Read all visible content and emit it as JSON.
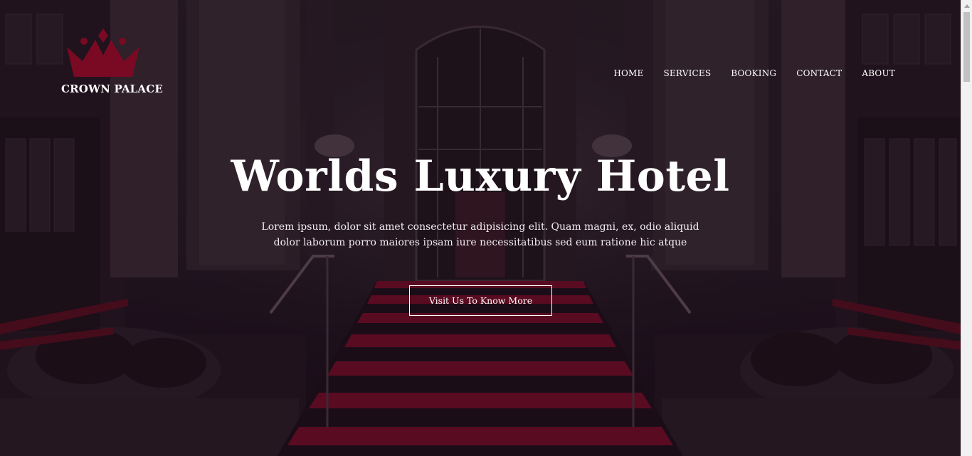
{
  "brand": {
    "name": "CROWN PALACE",
    "logo_icon": "crown-icon",
    "logo_color": "#7a0a23"
  },
  "nav": {
    "items": [
      {
        "label": "HOME"
      },
      {
        "label": "SERVICES"
      },
      {
        "label": "BOOKING"
      },
      {
        "label": "CONTACT"
      },
      {
        "label": "ABOUT"
      }
    ]
  },
  "hero": {
    "title": "Worlds Luxury Hotel",
    "description": "Lorem ipsum, dolor sit amet consectetur adipisicing elit. Quam magni, ex, odio aliquid dolor laborum porro maiores ipsam iure necessitatibus sed eum ratione hic atque",
    "button_label": "Visit Us To Know More",
    "carpet_color": "#7e0b27"
  }
}
